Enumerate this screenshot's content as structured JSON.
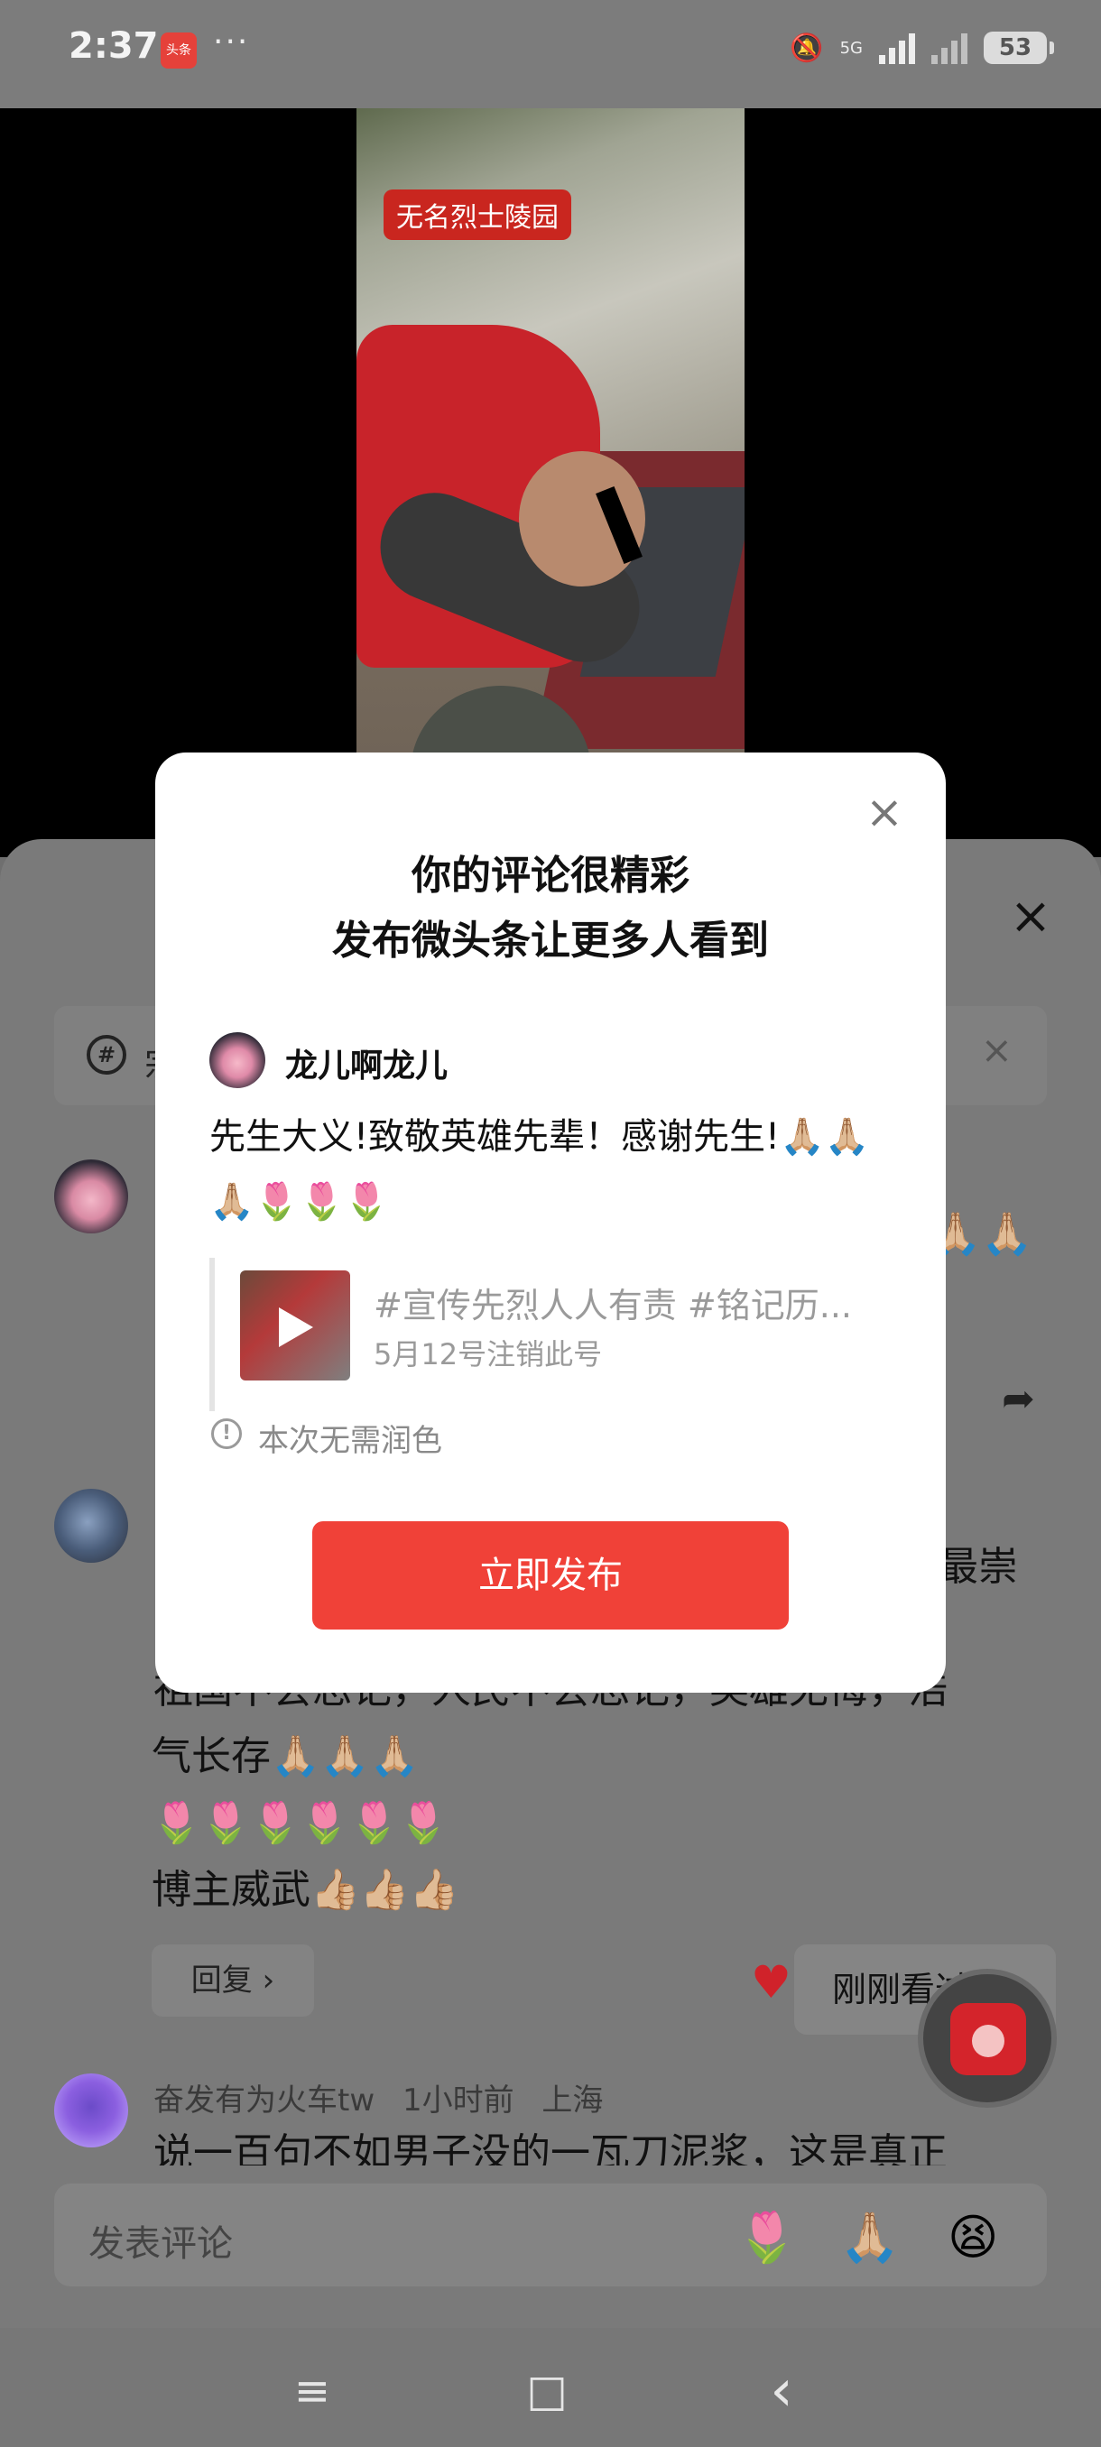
{
  "status_bar": {
    "time": "2:37",
    "app_badge": "头条",
    "more": "···",
    "network": "5G",
    "battery": "53"
  },
  "video": {
    "overlay_tag": "无名烈士陵园"
  },
  "sheet": {
    "topic_partial": "宗",
    "comment2_right_partial": "最崇",
    "comment2_lines": [
      "祖国不会忘记，人民不会忘记，英雄无悔，浩",
      "气长存🙏🏼🙏🏼🙏🏼",
      "🌷🌷🌷🌷🌷🌷",
      "博主威武👍🏼👍🏼👍🏼"
    ],
    "reply_label": "回复 ›",
    "seen_label": "刚刚看过 ⌄",
    "comment3_user": "奋发有为火车tw",
    "comment3_time": "1小时前",
    "comment3_location": "上海",
    "comment3_text": "说一百句不如男子没的一瓦刀泥浆，这是真正",
    "input_placeholder": "发表评论",
    "input_emojis": [
      "🌷",
      "🙏🏼",
      "😫"
    ],
    "peek_emoji": "🙏🏼🙏🏼"
  },
  "modal": {
    "title_line1": "你的评论很精彩",
    "title_line2": "发布微头条让更多人看到",
    "username": "龙儿啊龙儿",
    "comment_text": "先生大义!致敬英雄先辈！感谢先生!🙏🏼🙏🏼🙏🏼🌷🌷🌷",
    "quote_title": "#宣传先烈人人有责 #铭记历...",
    "quote_subtitle": "5月12号注销此号",
    "note": "本次无需润色",
    "publish_label": "立即发布",
    "close_icon": "×"
  },
  "navbar": {
    "menu_icon": "≡",
    "home_icon": "□",
    "back_icon": "‹"
  }
}
